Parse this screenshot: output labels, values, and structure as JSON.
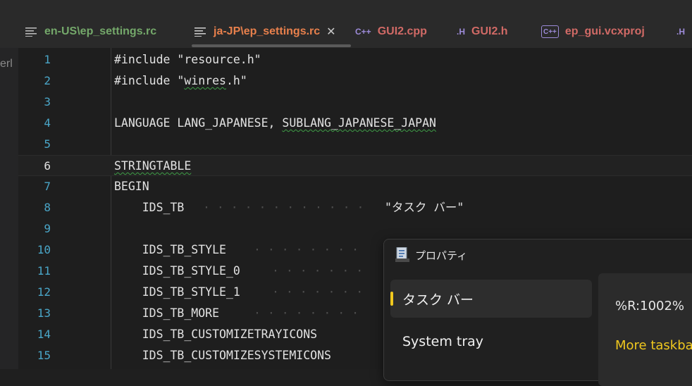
{
  "tabs": [
    {
      "label": "en-US\\ep_settings.rc",
      "icon": "document-lines-icon",
      "color": "#74a86a"
    },
    {
      "label": "ja-JP\\ep_settings.rc",
      "icon": "document-lines-icon",
      "color": "#e8804c",
      "active": true
    },
    {
      "label": "GUI2.cpp",
      "icon": "cpp-file-icon",
      "color": "#d16a66"
    },
    {
      "label": "GUI2.h",
      "icon": "header-file-icon",
      "color": "#d16a66"
    },
    {
      "label": "ep_gui.vcxproj",
      "icon": "project-file-icon",
      "color": "#d16a66"
    },
    {
      "label": "",
      "icon": "header-file-icon",
      "color": "#d16a66"
    }
  ],
  "left_panel": {
    "text": "erl"
  },
  "editor": {
    "current_line": 6,
    "lines": [
      {
        "n": "1",
        "text": "#include \"resource.h\""
      },
      {
        "n": "2",
        "text": "#include \"winres.h\""
      },
      {
        "n": "3",
        "text": ""
      },
      {
        "n": "4",
        "text": "LANGUAGE LANG_JAPANESE, SUBLANG_JAPANESE_JAPAN"
      },
      {
        "n": "5",
        "text": ""
      },
      {
        "n": "6",
        "text": "STRINGTABLE"
      },
      {
        "n": "7",
        "text": "BEGIN"
      },
      {
        "n": "8",
        "text": "    IDS_TB",
        "value": "\"タスク バー\""
      },
      {
        "n": "9",
        "text": ""
      },
      {
        "n": "10",
        "text": "    IDS_TB_STYLE"
      },
      {
        "n": "11",
        "text": "    IDS_TB_STYLE_0"
      },
      {
        "n": "12",
        "text": "    IDS_TB_STYLE_1"
      },
      {
        "n": "13",
        "text": "    IDS_TB_MORE"
      },
      {
        "n": "14",
        "text": "    IDS_TB_CUSTOMIZETRAYICONS"
      },
      {
        "n": "15",
        "text": "    IDS_TB_CUSTOMIZESYSTEMICONS"
      }
    ]
  },
  "dialog": {
    "title": "プロパティ",
    "icon": "properties-window-icon",
    "nav": [
      {
        "label": "タスク バー",
        "selected": true
      },
      {
        "label": "System tray",
        "selected": false
      }
    ],
    "content": {
      "percent_label": "%R:1002%",
      "link": "More taskba"
    },
    "accent": "#f0c81e"
  },
  "colors": {
    "background": "#1e1e1e",
    "line_number": "#4aa6c8",
    "squiggle": "#3e9e46"
  }
}
